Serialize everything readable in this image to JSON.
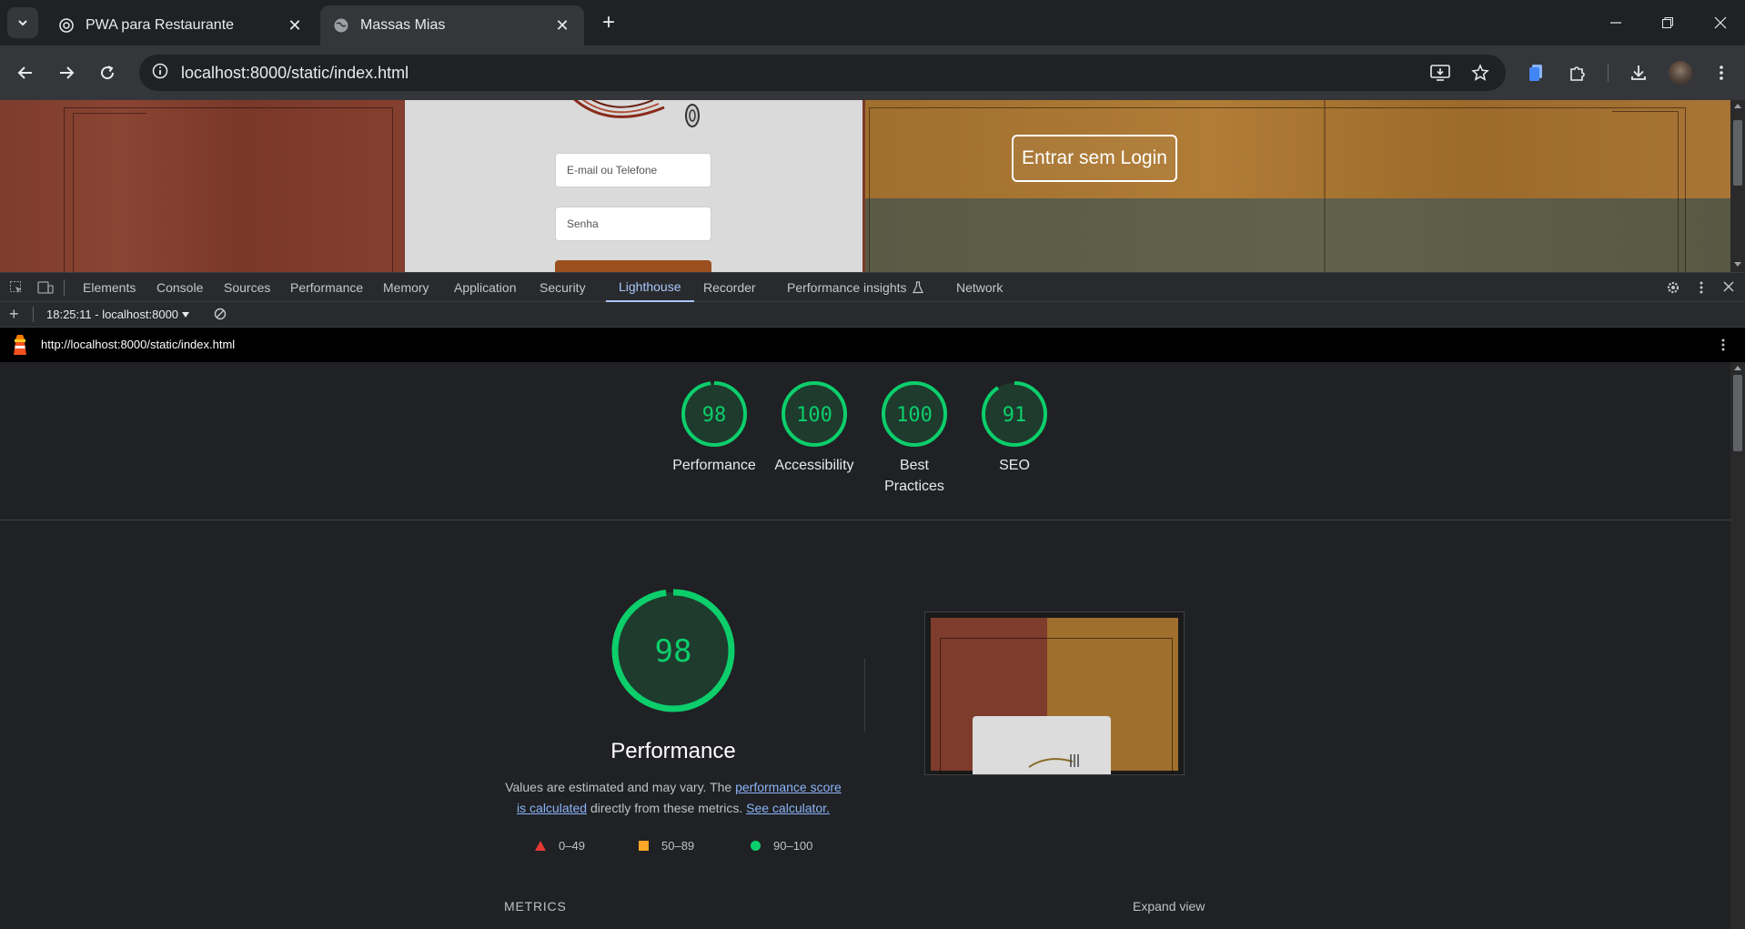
{
  "browser": {
    "tabs": [
      {
        "title": "PWA para Restaurante",
        "active": false,
        "favicon": "openai-icon"
      },
      {
        "title": "Massas Mias",
        "active": true,
        "favicon": "globe-icon"
      }
    ],
    "url": "localhost:8000/static/index.html"
  },
  "page": {
    "email_placeholder": "E-mail ou Telefone",
    "password_placeholder": "Senha",
    "guest_button": "Entrar sem Login"
  },
  "devtools": {
    "tabs": [
      "Elements",
      "Console",
      "Sources",
      "Performance",
      "Memory",
      "Application",
      "Security",
      "Lighthouse",
      "Recorder",
      "Performance insights",
      "Network"
    ],
    "active_tab": "Lighthouse",
    "report_selector": "18:25:11 - localhost:8000",
    "report_url": "http://localhost:8000/static/index.html"
  },
  "lighthouse": {
    "scores": [
      {
        "label": "Performance",
        "score": 98
      },
      {
        "label": "Accessibility",
        "score": 100
      },
      {
        "label": "Best Practices",
        "score": 100
      },
      {
        "label": "SEO",
        "score": 91
      }
    ],
    "main_score": 98,
    "main_title": "Performance",
    "desc_prefix": "Values are estimated and may vary. The ",
    "desc_link1": "performance score is calculated",
    "desc_mid": " directly from these metrics. ",
    "desc_link2": "See calculator.",
    "legend": [
      {
        "range": "0–49",
        "shape": "triangle",
        "color": "#e53935"
      },
      {
        "range": "50–89",
        "shape": "square",
        "color": "#ffa726"
      },
      {
        "range": "90–100",
        "shape": "circle",
        "color": "#0cce6b"
      }
    ],
    "metrics_label": "METRICS",
    "expand_label": "Expand view",
    "pass_color": "#0cce6b"
  }
}
